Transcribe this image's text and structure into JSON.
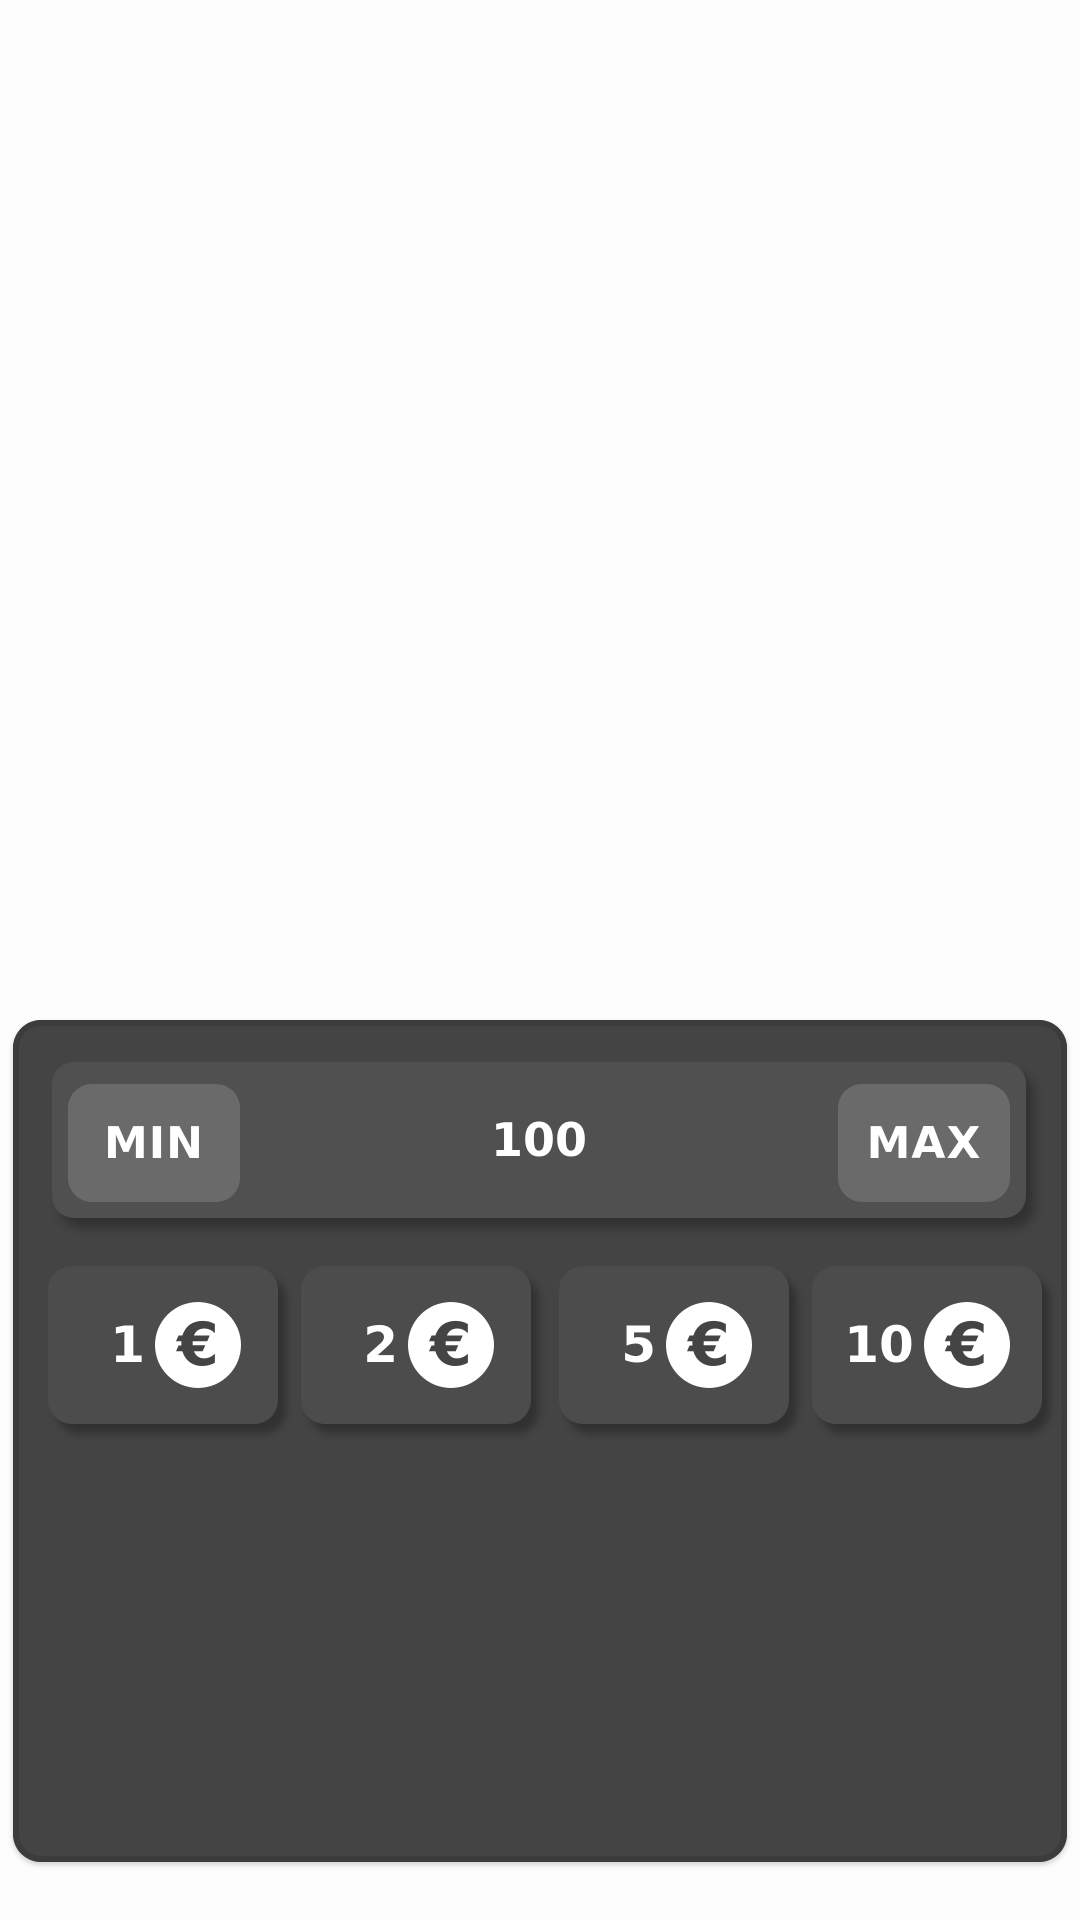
{
  "controls": {
    "min_label": "MIN",
    "max_label": "MAX",
    "bet_value": "100"
  },
  "coins": [
    {
      "amount": "1",
      "icon": "euro-coin-icon",
      "symbol": "€"
    },
    {
      "amount": "2",
      "icon": "euro-coin-icon",
      "symbol": "€"
    },
    {
      "amount": "5",
      "icon": "euro-coin-icon",
      "symbol": "€"
    },
    {
      "amount": "10",
      "icon": "euro-coin-icon",
      "symbol": "€"
    }
  ],
  "colors": {
    "panel": "#444444",
    "bar": "#505050",
    "button": "#6a6a6a",
    "coin_button": "#4c4c4c",
    "text": "#ffffff"
  }
}
